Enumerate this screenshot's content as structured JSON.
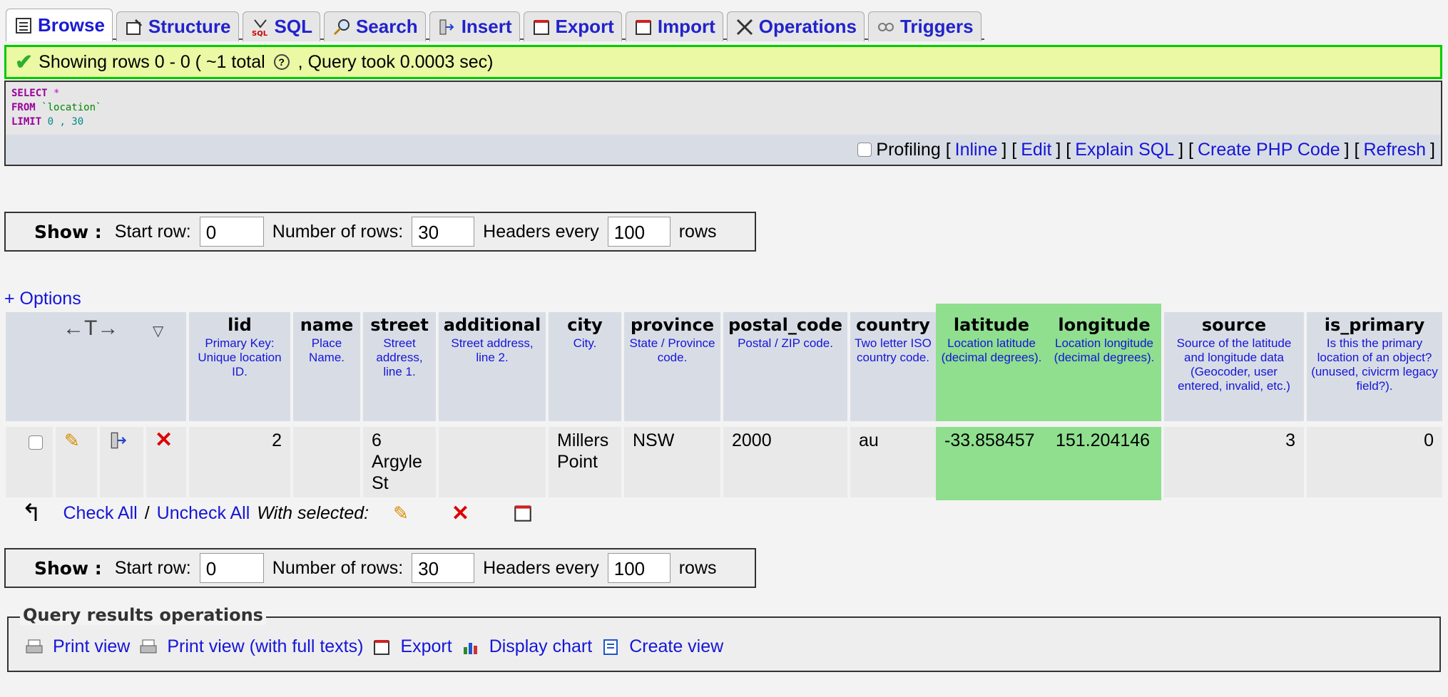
{
  "tabs": [
    {
      "label": "Browse",
      "icon": "browse-icon",
      "active": true
    },
    {
      "label": "Structure",
      "icon": "structure-icon"
    },
    {
      "label": "SQL",
      "icon": "sql-icon"
    },
    {
      "label": "Search",
      "icon": "search-icon"
    },
    {
      "label": "Insert",
      "icon": "insert-icon"
    },
    {
      "label": "Export",
      "icon": "export-icon"
    },
    {
      "label": "Import",
      "icon": "import-icon"
    },
    {
      "label": "Operations",
      "icon": "operations-icon"
    },
    {
      "label": "Triggers",
      "icon": "triggers-icon"
    }
  ],
  "notice": {
    "text_a": "Showing rows 0 - 0 ( ~1 total",
    "text_b": ", Query took 0.0003 sec)"
  },
  "sql": {
    "select": "SELECT",
    "star": "*",
    "from": "FROM",
    "table": "`location`",
    "limit": "LIMIT",
    "limit_vals": "0 , 30"
  },
  "sqlbar": {
    "profiling": "Profiling [",
    "inline": "Inline",
    "sep1": "] [",
    "edit": "Edit",
    "sep2": "] [",
    "explain": "Explain SQL",
    "sep3": "] [",
    "php": "Create PHP Code",
    "sep4": "] [",
    "refresh": "Refresh",
    "end": "]"
  },
  "shownav": {
    "show": "Show :",
    "start_label": "Start row:",
    "start_value": "0",
    "num_label": "Number of rows:",
    "num_value": "30",
    "headers_label": "Headers every",
    "headers_value": "100",
    "rows": "rows"
  },
  "options": "+ Options",
  "table": {
    "sort_arrows": "←T→",
    "columns": [
      {
        "name": "lid",
        "desc": "Primary Key: Unique location ID."
      },
      {
        "name": "name",
        "desc": "Place Name."
      },
      {
        "name": "street",
        "desc": "Street address, line 1."
      },
      {
        "name": "additional",
        "desc": "Street address, line 2."
      },
      {
        "name": "city",
        "desc": "City."
      },
      {
        "name": "province",
        "desc": "State / Province code."
      },
      {
        "name": "postal_code",
        "desc": "Postal / ZIP code."
      },
      {
        "name": "country",
        "desc": "Two letter ISO country code."
      },
      {
        "name": "latitude",
        "desc": "Location latitude (decimal degrees)."
      },
      {
        "name": "longitude",
        "desc": "Location longitude (decimal degrees)."
      },
      {
        "name": "source",
        "desc": "Source of the latitude and longitude data (Geocoder, user entered, invalid, etc.)"
      },
      {
        "name": "is_primary",
        "desc": "Is this the primary location of an object? (unused, civicrm legacy field?)."
      }
    ],
    "row": [
      "2",
      "",
      "6 Argyle St",
      "",
      "Millers Point",
      "NSW",
      "2000",
      "au",
      "-33.858457",
      "151.204146",
      "3",
      "0"
    ]
  },
  "bottom": {
    "check_all": "Check All",
    "slash": "/",
    "uncheck_all": "Uncheck All",
    "with_selected": "With selected:"
  },
  "qops": {
    "title": "Query results operations",
    "print": "Print view",
    "print_full": "Print view (with full texts)",
    "export": "Export",
    "chart": "Display chart",
    "create_view": "Create view"
  }
}
